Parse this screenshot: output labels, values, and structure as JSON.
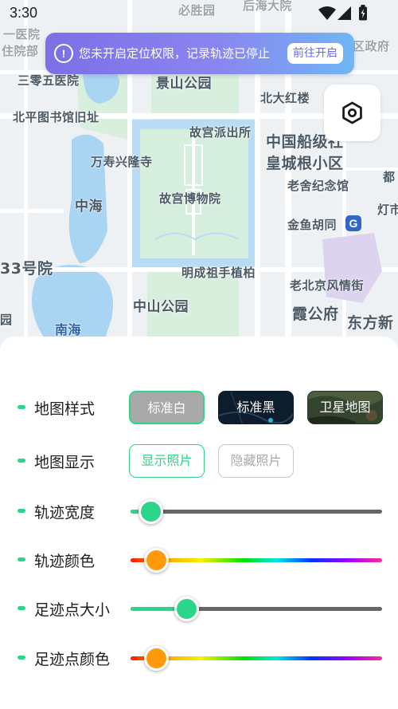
{
  "status_bar": {
    "time": "3:30",
    "icons": [
      "wifi-icon",
      "signal-icon",
      "battery-icon"
    ]
  },
  "map": {
    "labels": [
      {
        "id": "yiyiyuan",
        "text": "一医院"
      },
      {
        "id": "zhuyuanbu",
        "text": "住院部"
      },
      {
        "id": "biyuan",
        "text": "必胜园"
      },
      {
        "id": "houhai",
        "text": "后海大院"
      },
      {
        "id": "quzhengfu",
        "text": "区政府"
      },
      {
        "id": "sanlingwu",
        "text": "三零五医院"
      },
      {
        "id": "jingshan",
        "text": "景山公园"
      },
      {
        "id": "beida",
        "text": "北大红楼"
      },
      {
        "id": "beiping",
        "text": "北平图书馆旧址"
      },
      {
        "id": "gugongpcs",
        "text": "故宫派出所"
      },
      {
        "id": "chuanbo",
        "text": "中国船级社"
      },
      {
        "id": "huangcheng",
        "text": "皇城根小区"
      },
      {
        "id": "wanshou",
        "text": "万寿兴隆寺"
      },
      {
        "id": "dou",
        "text": "都"
      },
      {
        "id": "zhonghai",
        "text": "中海"
      },
      {
        "id": "gugong",
        "text": "故宫博物院"
      },
      {
        "id": "laoshe",
        "text": "老舍纪念馆"
      },
      {
        "id": "dengshi",
        "text": "灯市"
      },
      {
        "id": "jinyu",
        "text": "金鱼胡同"
      },
      {
        "id": "33hao",
        "text": "33号院"
      },
      {
        "id": "mingcheng",
        "text": "明成祖手植柏"
      },
      {
        "id": "laobeijing",
        "text": "老北京风情街"
      },
      {
        "id": "zhongshan",
        "text": "中山公园"
      },
      {
        "id": "xiagongfu",
        "text": "霞公府"
      },
      {
        "id": "dongfang",
        "text": "东方新"
      },
      {
        "id": "nanhai",
        "text": "南海"
      },
      {
        "id": "yuan",
        "text": "园"
      }
    ],
    "subway_icon": "metro-icon"
  },
  "notice": {
    "text": "您未开启定位权限，记录轨迹已停止",
    "icon": "alert-circle-icon",
    "button": "前往开启"
  },
  "settings_button": {
    "icon": "hexagon-gear-icon"
  },
  "panel": {
    "map_style": {
      "label": "地图样式",
      "options": [
        "标准白",
        "标准黑",
        "卫星地图"
      ],
      "selected": "标准白"
    },
    "map_display": {
      "label": "地图显示",
      "options": [
        "显示照片",
        "隐藏照片"
      ],
      "selected": "显示照片"
    },
    "track_width": {
      "label": "轨迹宽度",
      "value": 0.08
    },
    "track_color": {
      "label": "轨迹颜色",
      "value": 0.1
    },
    "footprint_size": {
      "label": "足迹点大小",
      "value": 0.22
    },
    "footprint_color": {
      "label": "足迹点颜色",
      "value": 0.1
    }
  },
  "colors": {
    "accent": "#2bd68a",
    "thumb_orange": "#ff9a0d",
    "notice_gradient_start": "#7b6fe6",
    "notice_gradient_end": "#6fb6f4"
  }
}
